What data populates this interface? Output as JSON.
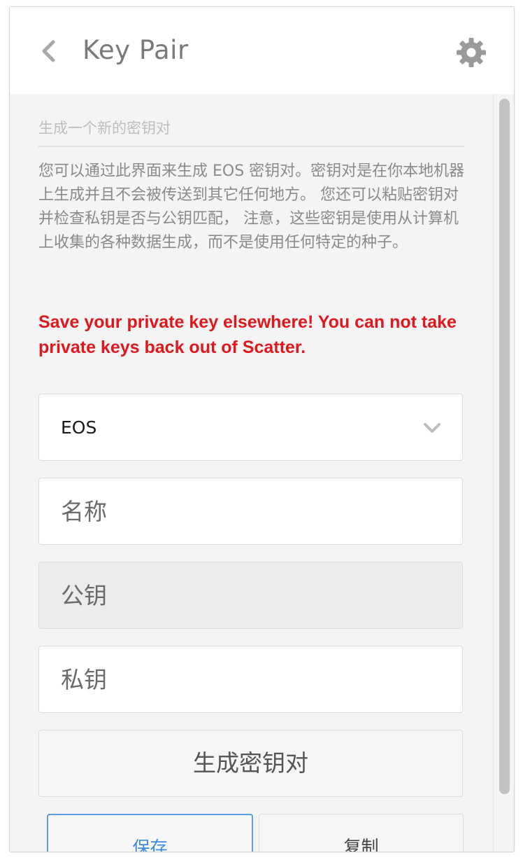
{
  "header": {
    "title": "Key Pair"
  },
  "section": {
    "title": "生成一个新的密钥对",
    "description": "您可以通过此界面来生成 EOS 密钥对。密钥对是在你本地机器上生成并且不会被传送到其它任何地方。 您还可以粘贴密钥对并检查私钥是否与公钥匹配， 注意，这些密钥是使用从计算机上收集的各种数据生成，而不是使用任何特定的种子。",
    "warning": "Save your private key elsewhere! You can not take private keys back out of Scatter."
  },
  "form": {
    "blockchain_select": {
      "value": "EOS"
    },
    "name_input": {
      "placeholder": "名称"
    },
    "public_key_input": {
      "placeholder": "公钥"
    },
    "private_key_input": {
      "placeholder": "私钥"
    },
    "generate_label": "生成密钥对",
    "save_label": "保存",
    "copy_label": "复制"
  },
  "colors": {
    "warning": "#e0181d",
    "accent": "#3f8be0",
    "icon_gray": "#9a9a9a"
  },
  "icons": {
    "back": "chevron-left-icon",
    "settings": "gear-icon",
    "dropdown": "chevron-down-icon"
  }
}
